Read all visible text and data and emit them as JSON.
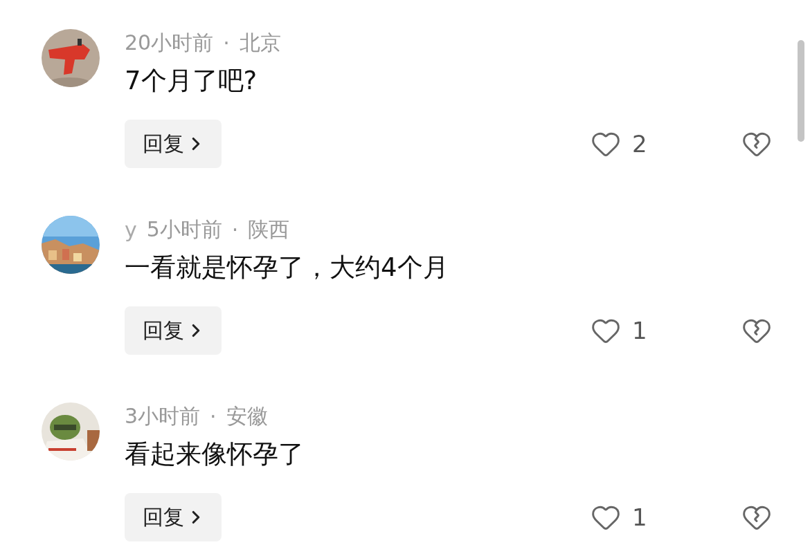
{
  "comments": [
    {
      "time": "20小时前",
      "separator": "·",
      "location": "北京",
      "text": "7个月了吧?",
      "reply": "回复",
      "likes": "2"
    },
    {
      "name": "y",
      "time": "5小时前",
      "separator": "·",
      "location": "陕西",
      "text": "一看就是怀孕了，大约4个月",
      "reply": "回复",
      "likes": "1"
    },
    {
      "time": "3小时前",
      "separator": "·",
      "location": "安徽",
      "text": "看起来像怀孕了",
      "reply": "回复",
      "likes": "1"
    }
  ]
}
